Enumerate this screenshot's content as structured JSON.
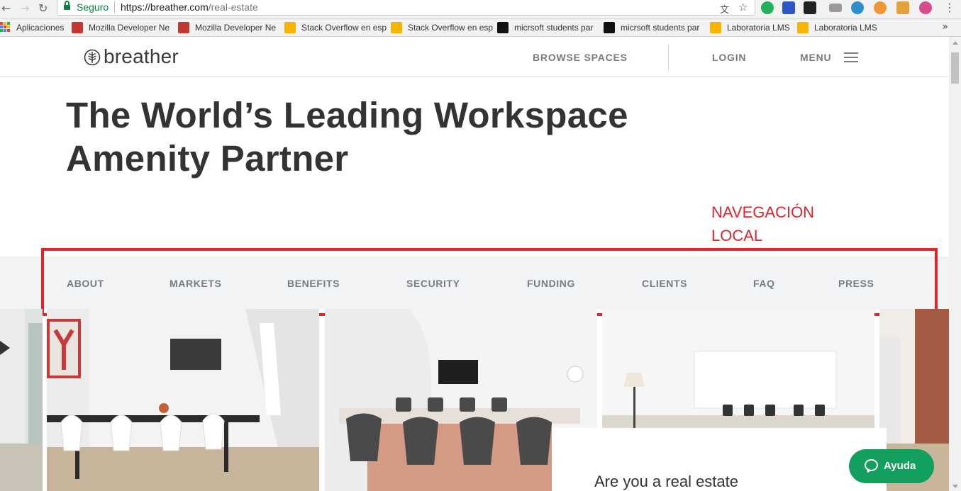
{
  "browser": {
    "secure_label": "Seguro",
    "url_host": "https://breather.com",
    "url_path": "/real-estate",
    "bookmarks": [
      {
        "label": "Aplicaciones",
        "icon": "apps-grid-icon"
      },
      {
        "label": "Mozilla Developer Ne",
        "icon": "mdn-icon",
        "color": "#c13832"
      },
      {
        "label": "Mozilla Developer Ne",
        "icon": "mdn-icon",
        "color": "#c13832"
      },
      {
        "label": "Stack Overflow en esp",
        "icon": "stackoverflow-icon",
        "color": "#f4b400"
      },
      {
        "label": "Stack Overflow en esp",
        "icon": "stackoverflow-icon",
        "color": "#f4b400"
      },
      {
        "label": "micrsoft students par",
        "icon": "medium-icon",
        "color": "#111111"
      },
      {
        "label": "micrsoft students par",
        "icon": "medium-icon",
        "color": "#111111"
      },
      {
        "label": "Laboratoria LMS",
        "icon": "laboratoria-icon",
        "color": "#f7b500"
      },
      {
        "label": "Laboratoria LMS",
        "icon": "laboratoria-icon",
        "color": "#f7b500"
      }
    ],
    "more_bookmarks": "»"
  },
  "header": {
    "logo_text": "breather",
    "browse_label": "BROWSE SPACES",
    "login_label": "LOGIN",
    "menu_label": "MENU"
  },
  "hero": {
    "title_line1": "The World’s Leading Workspace",
    "title_line2": "Amenity Partner"
  },
  "annotation": {
    "line1": "NAVEGACIÓN",
    "line2": "LOCAL",
    "color": "#e0262b"
  },
  "local_nav": {
    "items": [
      "ABOUT",
      "MARKETS",
      "BENEFITS",
      "SECURITY",
      "FUNDING",
      "CLIENTS",
      "FAQ",
      "PRESS"
    ]
  },
  "card": {
    "heading": "Are you a real estate"
  },
  "help": {
    "label": "Ayuda",
    "color": "#13a05f"
  }
}
